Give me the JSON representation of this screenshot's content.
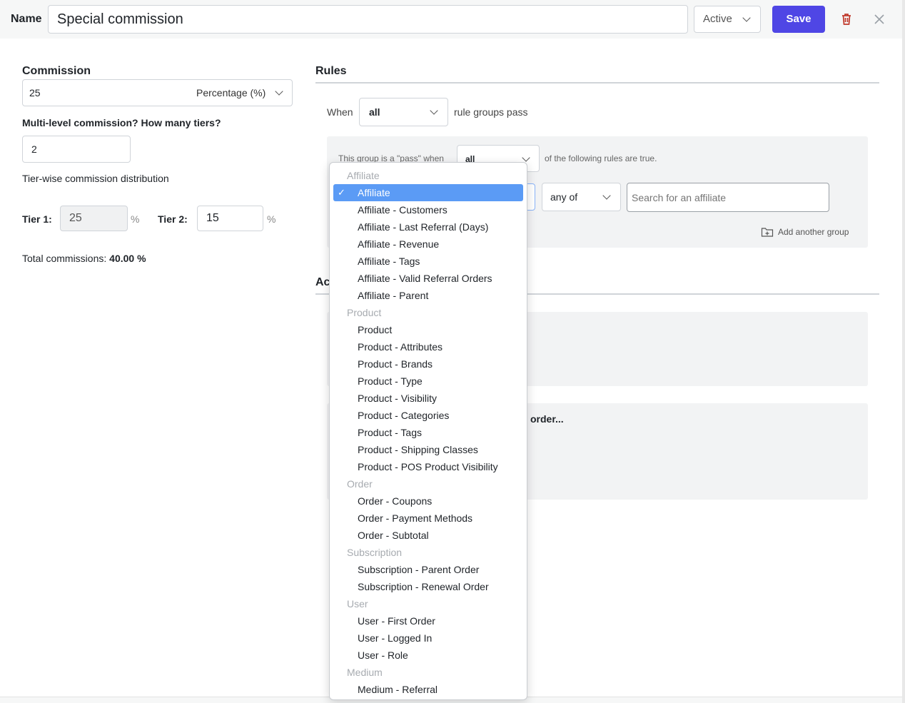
{
  "header": {
    "name_label": "Name",
    "name_value": "Special commission",
    "status": "Active",
    "save_label": "Save"
  },
  "commission": {
    "heading": "Commission",
    "value": "25",
    "type": "Percentage (%)",
    "multilevel_question": "Multi-level commission? How many tiers?",
    "tiers_value": "2",
    "distribution_label": "Tier-wise commission distribution",
    "tier1_label": "Tier 1:",
    "tier1_value": "25",
    "tier2_label": "Tier 2:",
    "tier2_value": "15",
    "percent_sign": "%",
    "total_label": "Total commissions:",
    "total_value": "40.00 %"
  },
  "rules": {
    "heading": "Rules",
    "when_label": "When",
    "when_value": "all",
    "groups_pass_label": "rule groups pass",
    "group_pass_text": "This group is a \"pass\" when",
    "group_mode_value": "all",
    "following_rules_text": "of the following rules are true.",
    "operator_value": "any of",
    "search_placeholder": "Search for an affiliate",
    "add_group_label": "Add another group"
  },
  "actions": {
    "heading_partial": "Ac",
    "order_text_partial": "order..."
  },
  "dropdown": {
    "groups": [
      {
        "label": "Affiliate",
        "items": [
          "Affiliate",
          "Affiliate - Customers",
          "Affiliate - Last Referral (Days)",
          "Affiliate - Revenue",
          "Affiliate - Tags",
          "Affiliate - Valid Referral Orders",
          "Affiliate - Parent"
        ]
      },
      {
        "label": "Product",
        "items": [
          "Product",
          "Product - Attributes",
          "Product - Brands",
          "Product - Type",
          "Product - Visibility",
          "Product - Categories",
          "Product - Tags",
          "Product - Shipping Classes",
          "Product - POS Product Visibility"
        ]
      },
      {
        "label": "Order",
        "items": [
          "Order - Coupons",
          "Order - Payment Methods",
          "Order - Subtotal"
        ]
      },
      {
        "label": "Subscription",
        "items": [
          "Subscription - Parent Order",
          "Subscription - Renewal Order"
        ]
      },
      {
        "label": "User",
        "items": [
          "User - First Order",
          "User - Logged In",
          "User - Role"
        ]
      },
      {
        "label": "Medium",
        "items": [
          "Medium - Referral"
        ]
      }
    ],
    "selected": "Affiliate",
    "check_glyph": "✓"
  },
  "colors": {
    "primary": "#4f46e5",
    "selected": "#5b9bf5",
    "danger": "#c0392b"
  }
}
